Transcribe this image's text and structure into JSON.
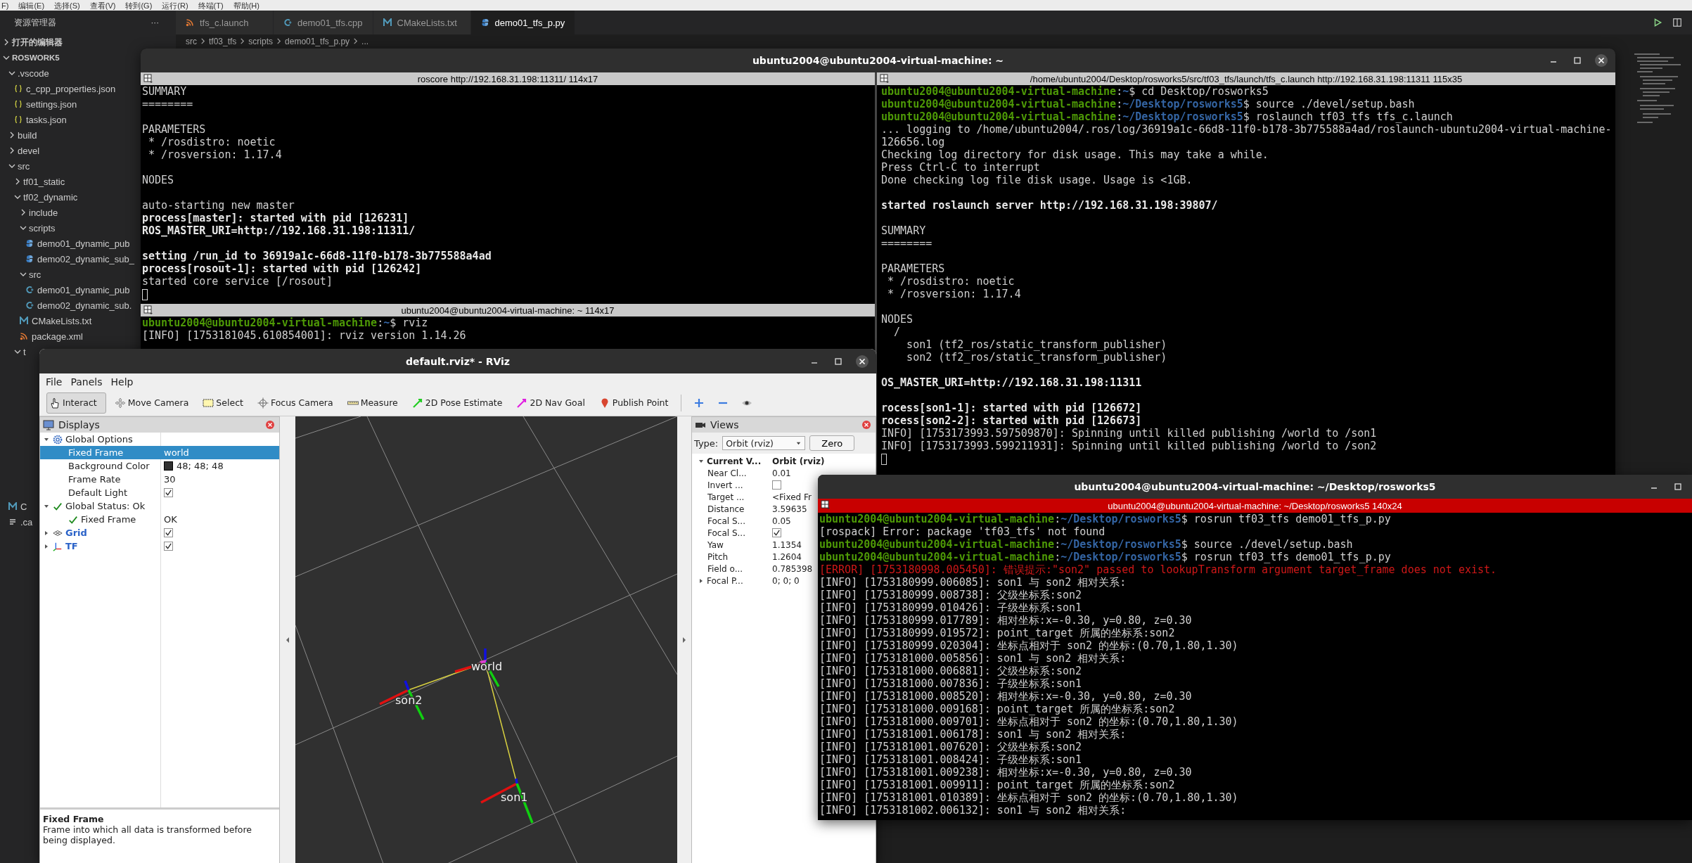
{
  "vscode": {
    "menu": [
      "F)",
      "编辑(E)",
      "选择(S)",
      "查看(V)",
      "转到(G)",
      "运行(R)",
      "终端(T)",
      "帮助(H)"
    ],
    "explorer": {
      "title": "资源管理器",
      "more": "···",
      "open_editors": {
        "label": "打开的编辑器",
        "expanded": false
      },
      "workspace": {
        "label": "ROSWORK5",
        "expanded": true,
        "children": [
          {
            "label": ".vscode",
            "kind": "folder",
            "expanded": true,
            "children": [
              {
                "label": "c_cpp_properties.json",
                "kind": "json"
              },
              {
                "label": "settings.json",
                "kind": "json"
              },
              {
                "label": "tasks.json",
                "kind": "json"
              }
            ]
          },
          {
            "label": "build",
            "kind": "folder",
            "expanded": false
          },
          {
            "label": "devel",
            "kind": "folder",
            "expanded": false
          },
          {
            "label": "src",
            "kind": "folder",
            "expanded": true,
            "children": [
              {
                "label": "tf01_static",
                "kind": "folder",
                "expanded": false
              },
              {
                "label": "tf02_dynamic",
                "kind": "folder",
                "expanded": true,
                "children": [
                  {
                    "label": "include",
                    "kind": "folder",
                    "expanded": false
                  },
                  {
                    "label": "scripts",
                    "kind": "folder",
                    "expanded": true,
                    "children": [
                      {
                        "label": "demo01_dynamic_pub",
                        "kind": "py"
                      },
                      {
                        "label": "demo02_dynamic_sub_",
                        "kind": "py"
                      }
                    ]
                  },
                  {
                    "label": "src",
                    "kind": "folder",
                    "expanded": true,
                    "children": [
                      {
                        "label": "demo01_dynamic_pub",
                        "kind": "cpp"
                      },
                      {
                        "label": "demo02_dynamic_sub.",
                        "kind": "cpp"
                      }
                    ]
                  },
                  {
                    "label": "CMakeLists.txt",
                    "kind": "cmake"
                  },
                  {
                    "label": "package.xml",
                    "kind": "xml"
                  }
                ]
              },
              {
                "label": "t",
                "kind": "folder",
                "expanded": true
              }
            ]
          },
          {
            "label": "C",
            "kind": "cmake"
          },
          {
            "label": ".ca",
            "kind": "file"
          }
        ]
      }
    },
    "tabs": [
      {
        "label": "tfs_c.launch",
        "kind": "xml",
        "selected": false
      },
      {
        "label": "demo01_tfs.cpp",
        "kind": "cpp",
        "selected": false
      },
      {
        "label": "CMakeLists.txt",
        "kind": "cmake",
        "selected": false
      },
      {
        "label": "demo01_tfs_p.py",
        "kind": "py",
        "selected": true
      }
    ],
    "breadcrumb": [
      "src",
      "tf03_tfs",
      "scripts",
      "demo01_tfs_p.py",
      "..."
    ]
  },
  "terminal_window": {
    "title": "ubuntu2004@ubuntu2004-virtual-machine: ~",
    "panes": [
      {
        "title": "roscore http://192.168.31.198:11311/ 114x17",
        "focused": false,
        "lines": [
          {
            "kind": "plain",
            "text": "SUMMARY"
          },
          {
            "kind": "plain",
            "text": "========"
          },
          {
            "kind": "blank"
          },
          {
            "kind": "plain",
            "text": "PARAMETERS"
          },
          {
            "kind": "plain",
            "text": " * /rosdistro: noetic"
          },
          {
            "kind": "plain",
            "text": " * /rosversion: 1.17.4"
          },
          {
            "kind": "blank"
          },
          {
            "kind": "plain",
            "text": "NODES"
          },
          {
            "kind": "blank"
          },
          {
            "kind": "plain",
            "text": "auto-starting new master"
          },
          {
            "kind": "bold",
            "text": "process[master]: started with pid [126231]"
          },
          {
            "kind": "bold",
            "text": "ROS_MASTER_URI=http://192.168.31.198:11311/"
          },
          {
            "kind": "blank"
          },
          {
            "kind": "bold",
            "text": "setting /run_id to 36919a1c-66d8-11f0-b178-3b775588a4ad"
          },
          {
            "kind": "bold",
            "text": "process[rosout-1]: started with pid [126242]"
          },
          {
            "kind": "plain",
            "text": "started core service [/rosout]"
          },
          {
            "kind": "cursor"
          }
        ]
      },
      {
        "title": "ubuntu2004@ubuntu2004-virtual-machine: ~ 114x17",
        "focused": false,
        "lines": [
          {
            "kind": "prompt",
            "user": "ubuntu2004@ubuntu2004-virtual-machine",
            "sep": ":",
            "path": "~",
            "cmd": "$ rviz"
          },
          {
            "kind": "plain",
            "text": "[INFO] [1753181045.610854001]: rviz version 1.14.26"
          }
        ]
      },
      {
        "title": "/home/ubuntu2004/Desktop/rosworks5/src/tf03_tfs/launch/tfs_c.launch http://192.168.31.198:11311 115x35",
        "focused": false,
        "lines": [
          {
            "kind": "prompt",
            "user": "ubuntu2004@ubuntu2004-virtual-machine",
            "sep": ":",
            "path": "~",
            "cmd": "$ cd Desktop/rosworks5"
          },
          {
            "kind": "prompt",
            "user": "ubuntu2004@ubuntu2004-virtual-machine",
            "sep": ":",
            "path": "~/Desktop/rosworks5",
            "cmd": "$ source ./devel/setup.bash"
          },
          {
            "kind": "prompt",
            "user": "ubuntu2004@ubuntu2004-virtual-machine",
            "sep": ":",
            "path": "~/Desktop/rosworks5",
            "cmd": "$ roslaunch tf03_tfs tfs_c.launch"
          },
          {
            "kind": "plain",
            "text": "... logging to /home/ubuntu2004/.ros/log/36919a1c-66d8-11f0-b178-3b775588a4ad/roslaunch-ubuntu2004-virtual-machine-"
          },
          {
            "kind": "plain",
            "text": "126656.log"
          },
          {
            "kind": "plain",
            "text": "Checking log directory for disk usage. This may take a while."
          },
          {
            "kind": "plain",
            "text": "Press Ctrl-C to interrupt"
          },
          {
            "kind": "plain",
            "text": "Done checking log file disk usage. Usage is <1GB."
          },
          {
            "kind": "blank"
          },
          {
            "kind": "bold",
            "text": "started roslaunch server http://192.168.31.198:39807/"
          },
          {
            "kind": "blank"
          },
          {
            "kind": "plain",
            "text": "SUMMARY"
          },
          {
            "kind": "plain",
            "text": "========"
          },
          {
            "kind": "blank"
          },
          {
            "kind": "plain",
            "text": "PARAMETERS"
          },
          {
            "kind": "plain",
            "text": " * /rosdistro: noetic"
          },
          {
            "kind": "plain",
            "text": " * /rosversion: 1.17.4"
          },
          {
            "kind": "blank"
          },
          {
            "kind": "plain",
            "text": "NODES"
          },
          {
            "kind": "plain",
            "text": "  /"
          },
          {
            "kind": "plain",
            "text": "    son1 (tf2_ros/static_transform_publisher)"
          },
          {
            "kind": "plain",
            "text": "    son2 (tf2_ros/static_transform_publisher)"
          },
          {
            "kind": "blank"
          },
          {
            "kind": "bold",
            "text": "OS_MASTER_URI=http://192.168.31.198:11311"
          },
          {
            "kind": "blank"
          },
          {
            "kind": "bold",
            "text": "rocess[son1-1]: started with pid [126672]"
          },
          {
            "kind": "bold",
            "text": "rocess[son2-2]: started with pid [126673]"
          },
          {
            "kind": "plain",
            "text": "INFO] [1753173993.597509870]: Spinning until killed publishing /world to /son1"
          },
          {
            "kind": "plain",
            "text": "INFO] [1753173993.599211931]: Spinning until killed publishing /world to /son2"
          },
          {
            "kind": "cursor"
          }
        ]
      }
    ]
  },
  "rviz": {
    "title": "default.rviz* - RViz",
    "menu": [
      "File",
      "Panels",
      "Help"
    ],
    "toolbar": [
      {
        "label": "Interact",
        "kind": "interact",
        "selected": true
      },
      {
        "label": "Move Camera",
        "kind": "move",
        "selected": false
      },
      {
        "label": "Select",
        "kind": "select",
        "selected": false
      },
      {
        "label": "Focus Camera",
        "kind": "focus",
        "selected": false
      },
      {
        "label": "Measure",
        "kind": "measure",
        "selected": false
      },
      {
        "label": "2D Pose Estimate",
        "kind": "pose",
        "selected": false
      },
      {
        "label": "2D Nav Goal",
        "kind": "goal",
        "selected": false
      },
      {
        "label": "Publish Point",
        "kind": "point",
        "selected": false
      }
    ],
    "displays": {
      "title": "Displays",
      "items": [
        {
          "label": "Global Options",
          "kind": "group",
          "expanded": true,
          "selected": false,
          "children": [
            {
              "label": "Fixed Frame",
              "kind": "value",
              "value": "world",
              "selected": true
            },
            {
              "label": "Background Color",
              "kind": "color",
              "value": "48; 48; 48",
              "color": "#303030",
              "selected": false
            },
            {
              "label": "Frame Rate",
              "kind": "value",
              "value": "30",
              "selected": false
            },
            {
              "label": "Default Light",
              "kind": "checkbox",
              "checked": true,
              "selected": false
            }
          ]
        },
        {
          "label": "Global Status: Ok",
          "kind": "group",
          "expanded": true,
          "selected": false,
          "children": [
            {
              "label": "Fixed Frame",
              "kind": "status",
              "value": "OK",
              "selected": false
            }
          ]
        },
        {
          "label": "Grid",
          "kind": "display",
          "expanded": false,
          "checked": true,
          "selected": false
        },
        {
          "label": "TF",
          "kind": "display",
          "expanded": false,
          "checked": true,
          "selected": false
        }
      ],
      "help": {
        "title": "Fixed Frame",
        "text": "Frame into which all data is transformed before being displayed."
      }
    },
    "view": {
      "frames": [
        {
          "label": "world"
        },
        {
          "label": "son2"
        },
        {
          "label": "son1"
        }
      ]
    },
    "views": {
      "title": "Views",
      "type_label": "Type:",
      "type_value": "Orbit (rviz)",
      "zero": "Zero",
      "rows": [
        {
          "label": "Current V...",
          "kind": "group",
          "value": "Orbit (rviz)",
          "expanded": true
        },
        {
          "label": "Near Cl...",
          "kind": "value",
          "value": "0.01"
        },
        {
          "label": "Invert ...",
          "kind": "checkbox",
          "checked": false
        },
        {
          "label": "Target ...",
          "kind": "value",
          "value": "<Fixed Fr"
        },
        {
          "label": "Distance",
          "kind": "value",
          "value": "3.59635"
        },
        {
          "label": "Focal S...",
          "kind": "value",
          "value": "0.05"
        },
        {
          "label": "Focal S...",
          "kind": "checkbox",
          "checked": true
        },
        {
          "label": "Yaw",
          "kind": "value",
          "value": "1.1354"
        },
        {
          "label": "Pitch",
          "kind": "value",
          "value": "1.2604"
        },
        {
          "label": "Field o...",
          "kind": "value",
          "value": "0.785398"
        },
        {
          "label": "Focal P...",
          "kind": "group",
          "value": "0; 0; 0",
          "expanded": false
        }
      ]
    }
  },
  "terminal_window_2": {
    "title": "ubuntu2004@ubuntu2004-virtual-machine: ~/Desktop/rosworks5",
    "panes": [
      {
        "title": "ubuntu2004@ubuntu2004-virtual-machine: ~/Desktop/rosworks5 140x24",
        "focused": true,
        "lines": [
          {
            "kind": "prompt",
            "user": "ubuntu2004@ubuntu2004-virtual-machine",
            "sep": ":",
            "path": "~/Desktop/rosworks5",
            "cmd": "$ rosrun tf03_tfs demo01_tfs_p.py"
          },
          {
            "kind": "plain",
            "text": "[rospack] Error: package 'tf03_tfs' not found"
          },
          {
            "kind": "prompt",
            "user": "ubuntu2004@ubuntu2004-virtual-machine",
            "sep": ":",
            "path": "~/Desktop/rosworks5",
            "cmd": "$ source ./devel/setup.bash"
          },
          {
            "kind": "prompt",
            "user": "ubuntu2004@ubuntu2004-virtual-machine",
            "sep": ":",
            "path": "~/Desktop/rosworks5",
            "cmd": "$ rosrun tf03_tfs demo01_tfs_p.py"
          },
          {
            "kind": "error",
            "text": "[ERROR] [1753180998.005450]: 错误提示:\"son2\" passed to lookupTransform argument target_frame does not exist."
          },
          {
            "kind": "plain",
            "text": "[INFO] [1753180999.006085]: son1 与 son2 相对关系:"
          },
          {
            "kind": "plain",
            "text": "[INFO] [1753180999.008738]: 父级坐标系:son2"
          },
          {
            "kind": "plain",
            "text": "[INFO] [1753180999.010426]: 子级坐标系:son1"
          },
          {
            "kind": "plain",
            "text": "[INFO] [1753180999.017789]: 相对坐标:x=-0.30, y=0.80, z=0.30"
          },
          {
            "kind": "plain",
            "text": "[INFO] [1753180999.019572]: point_target 所属的坐标系:son2"
          },
          {
            "kind": "plain",
            "text": "[INFO] [1753180999.020304]: 坐标点相对于 son2 的坐标:(0.70,1.80,1.30)"
          },
          {
            "kind": "plain",
            "text": "[INFO] [1753181000.005856]: son1 与 son2 相对关系:"
          },
          {
            "kind": "plain",
            "text": "[INFO] [1753181000.006881]: 父级坐标系:son2"
          },
          {
            "kind": "plain",
            "text": "[INFO] [1753181000.007836]: 子级坐标系:son1"
          },
          {
            "kind": "plain",
            "text": "[INFO] [1753181000.008520]: 相对坐标:x=-0.30, y=0.80, z=0.30"
          },
          {
            "kind": "plain",
            "text": "[INFO] [1753181000.009168]: point_target 所属的坐标系:son2"
          },
          {
            "kind": "plain",
            "text": "[INFO] [1753181000.009701]: 坐标点相对于 son2 的坐标:(0.70,1.80,1.30)"
          },
          {
            "kind": "plain",
            "text": "[INFO] [1753181001.006178]: son1 与 son2 相对关系:"
          },
          {
            "kind": "plain",
            "text": "[INFO] [1753181001.007620]: 父级坐标系:son2"
          },
          {
            "kind": "plain",
            "text": "[INFO] [1753181001.008424]: 子级坐标系:son1"
          },
          {
            "kind": "plain",
            "text": "[INFO] [1753181001.009238]: 相对坐标:x=-0.30, y=0.80, z=0.30"
          },
          {
            "kind": "plain",
            "text": "[INFO] [1753181001.009911]: point_target 所属的坐标系:son2"
          },
          {
            "kind": "plain",
            "text": "[INFO] [1753181001.010389]: 坐标点相对于 son2 的坐标:(0.70,1.80,1.30)"
          },
          {
            "kind": "plain",
            "text": "[INFO] [1753181002.006132]: son1 与 son2 相对关系:"
          }
        ]
      }
    ]
  }
}
